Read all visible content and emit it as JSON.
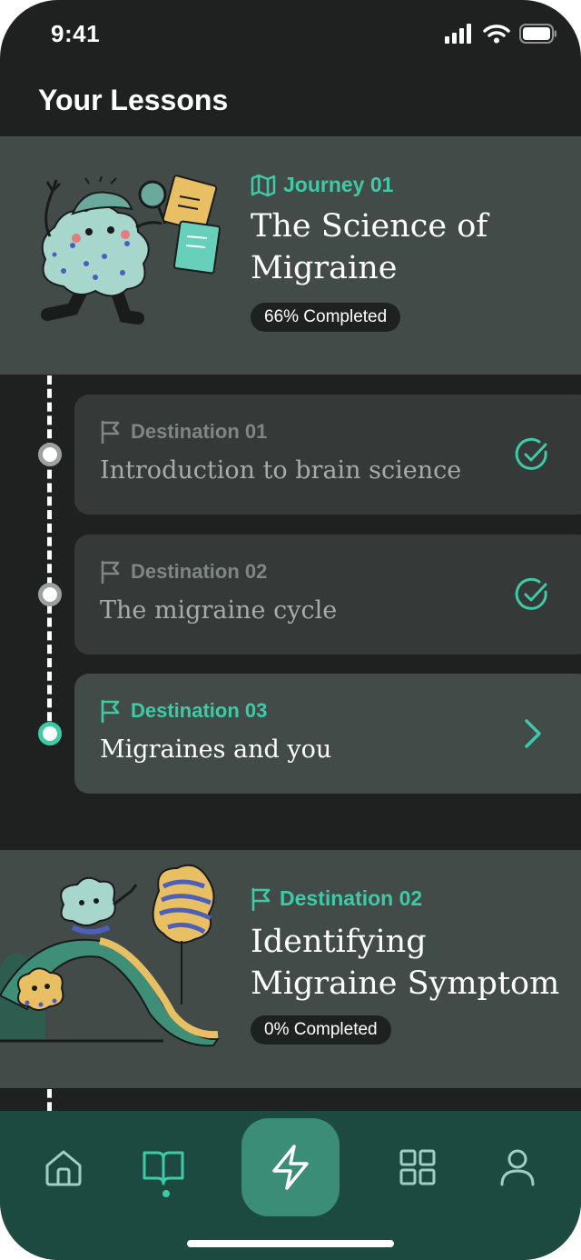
{
  "status_bar": {
    "time": "9:41"
  },
  "header": {
    "title": "Your Lessons"
  },
  "journeys": [
    {
      "tag": "Journey 01",
      "title_line1": "The Science of",
      "title_line2": "Migraine",
      "progress": "66% Completed",
      "destinations": [
        {
          "label": "Destination 01",
          "title": "Introduction to brain science",
          "state": "completed"
        },
        {
          "label": "Destination 02",
          "title": "The migraine cycle",
          "state": "completed"
        },
        {
          "label": "Destination 03",
          "title": "Migraines and you",
          "state": "current"
        }
      ]
    },
    {
      "tag": "Destination 02",
      "title_line1": "Identifying",
      "title_line2": "Migraine Symptom",
      "progress": "0% Completed"
    }
  ],
  "bottom_nav": {
    "items": [
      "home-icon",
      "book-icon",
      "lightning-icon",
      "grid-icon",
      "profile-icon"
    ],
    "active": "book-icon"
  },
  "colors": {
    "accent": "#3ec9a7",
    "background": "#1f2120",
    "card": "#434b49",
    "card_muted": "#353937",
    "nav": "#1d4a40"
  }
}
